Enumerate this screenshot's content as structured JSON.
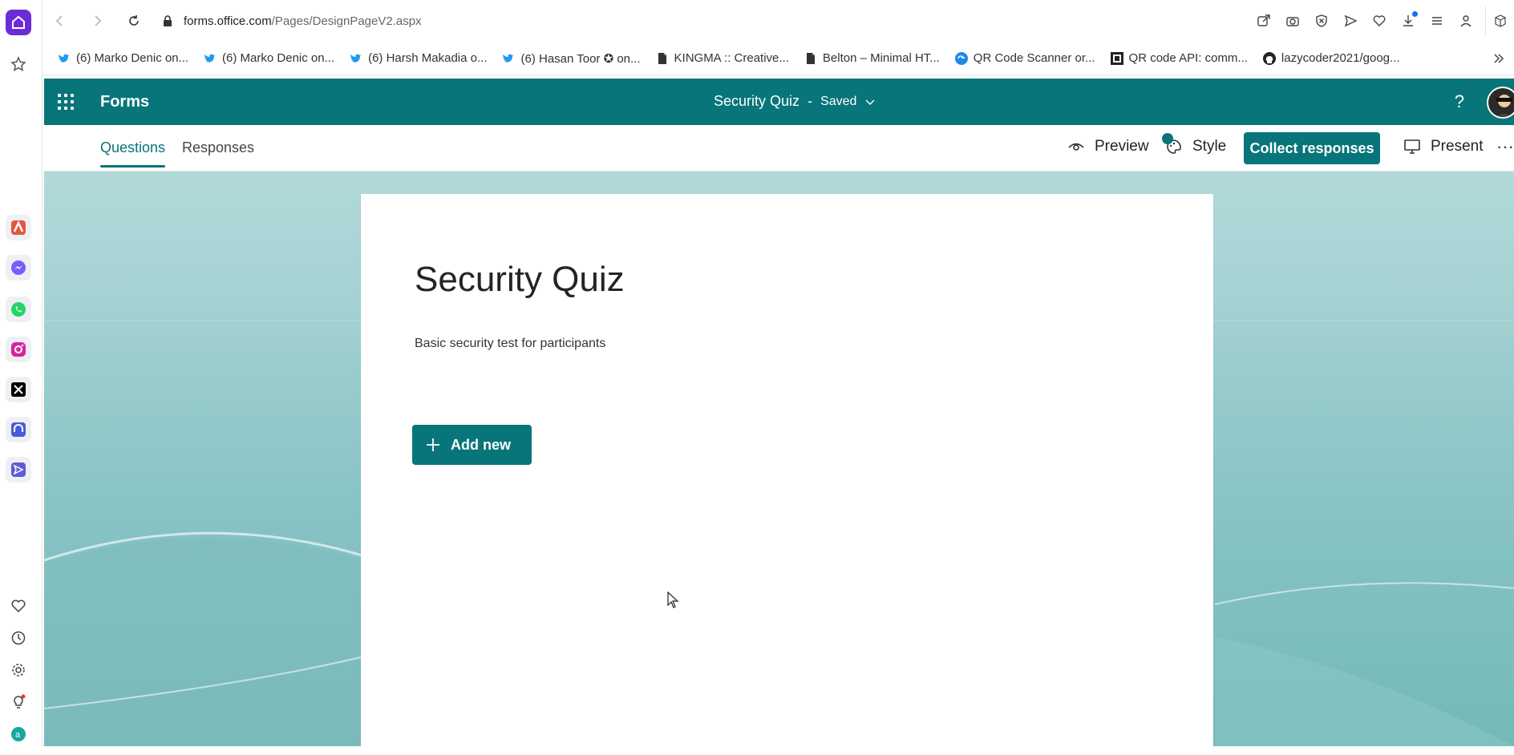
{
  "browser": {
    "url_host": "forms.office.com",
    "url_path": "/Pages/DesignPageV2.aspx",
    "nav_icons": [
      "back-icon",
      "forward-icon",
      "reload-icon"
    ],
    "toolbar_icons": [
      "share-icon",
      "camera-icon",
      "shield-icon",
      "send-icon",
      "heart-icon",
      "download-icon",
      "menu-icon",
      "profile-icon",
      "box-icon"
    ]
  },
  "bookmarks": [
    {
      "label": "(6) Marko Denic on...",
      "icon": "twitter-icon"
    },
    {
      "label": "(6) Marko Denic on...",
      "icon": "twitter-icon"
    },
    {
      "label": "(6) Harsh Makadia o...",
      "icon": "twitter-icon"
    },
    {
      "label": "(6) Hasan Toor ✪ on...",
      "icon": "twitter-icon"
    },
    {
      "label": "KINGMA :: Creative...",
      "icon": "file-icon"
    },
    {
      "label": "Belton – Minimal HT...",
      "icon": "file-icon"
    },
    {
      "label": "QR Code Scanner or...",
      "icon": "qr-icon"
    },
    {
      "label": "QR code API: comm...",
      "icon": "qr-api-icon"
    },
    {
      "label": "lazycoder2021/goog...",
      "icon": "github-icon"
    }
  ],
  "forms": {
    "app_name": "Forms",
    "doc_title": "Security Quiz",
    "separator": "-",
    "save_status": "Saved",
    "help": "?"
  },
  "subbar": {
    "tab_questions": "Questions",
    "tab_responses": "Responses",
    "preview": "Preview",
    "style": "Style",
    "collect": "Collect responses",
    "present": "Present",
    "more": "···"
  },
  "form": {
    "title": "Security Quiz",
    "description": "Basic security test for participants",
    "add_new": "Add new"
  },
  "colors": {
    "brand": "#077579",
    "sidebar_home": "#6c2bd9"
  }
}
